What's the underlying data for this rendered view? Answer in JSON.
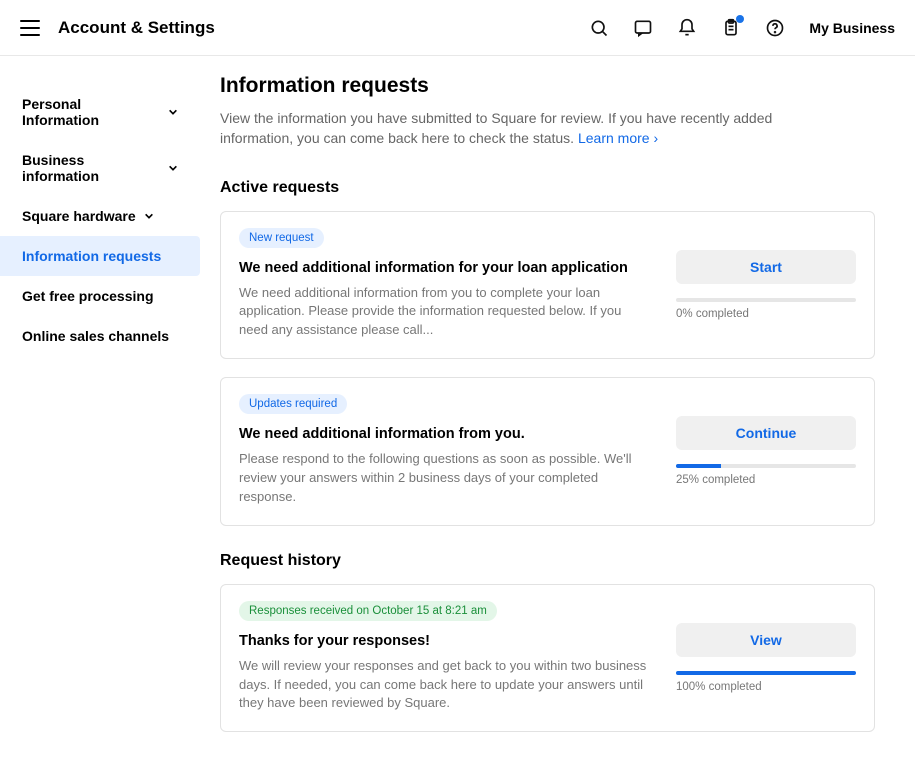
{
  "header": {
    "title": "Account & Settings",
    "business_name": "My Business"
  },
  "sidebar": {
    "items": [
      {
        "label": "Personal Information",
        "has_chevron": true,
        "active": false
      },
      {
        "label": "Business information",
        "has_chevron": true,
        "active": false
      },
      {
        "label": "Square hardware",
        "has_chevron": true,
        "active": false
      },
      {
        "label": "Information requests",
        "has_chevron": false,
        "active": true
      },
      {
        "label": "Get free processing",
        "has_chevron": false,
        "active": false
      },
      {
        "label": "Online sales channels",
        "has_chevron": false,
        "active": false
      }
    ]
  },
  "page": {
    "heading": "Information requests",
    "description": "View the information you have submitted to Square for review. If you have recently added information, you can come back here to check the status. ",
    "learn_more_label": "Learn more"
  },
  "active": {
    "section_label": "Active requests",
    "items": [
      {
        "badge": "New request",
        "title": "We need additional information for your loan application",
        "body": "We need additional information from you to complete your loan application. Please provide the information requested below. If you need any assistance please call...",
        "button": "Start",
        "progress_percent": 0,
        "progress_label": "0% completed"
      },
      {
        "badge": "Updates required",
        "title": "We need additional information from you.",
        "body": "Please respond to the following questions as soon as possible. We'll review your answers within 2 business days of your completed response.",
        "button": "Continue",
        "progress_percent": 25,
        "progress_label": "25% completed"
      }
    ]
  },
  "history": {
    "section_label": "Request history",
    "items": [
      {
        "badge": "Responses received on October 15 at 8:21 am",
        "title": "Thanks for your responses!",
        "body": "We will review your responses and get back to you within two business days. If needed, you can come back here to update your answers until they have been reviewed by Square.",
        "button": "View",
        "progress_percent": 100,
        "progress_label": "100% completed"
      }
    ]
  }
}
